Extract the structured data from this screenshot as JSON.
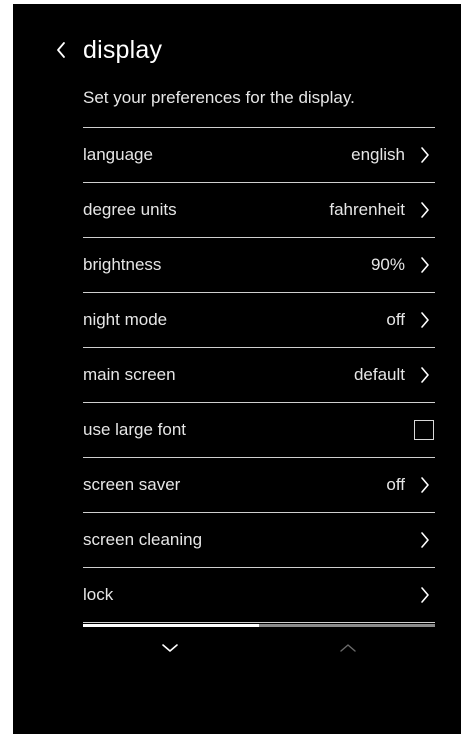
{
  "header": {
    "title": "display",
    "back_icon": "chevron-left-icon"
  },
  "subtitle": "Set your preferences for the display.",
  "settings": [
    {
      "label": "language",
      "value": "english",
      "control": "chevron"
    },
    {
      "label": "degree units",
      "value": "fahrenheit",
      "control": "chevron"
    },
    {
      "label": "brightness",
      "value": "90%",
      "control": "chevron"
    },
    {
      "label": "night mode",
      "value": "off",
      "control": "chevron"
    },
    {
      "label": "main screen",
      "value": "default",
      "control": "chevron"
    },
    {
      "label": "use large font",
      "value": "",
      "control": "checkbox",
      "checked": false
    },
    {
      "label": "screen saver",
      "value": "off",
      "control": "chevron"
    },
    {
      "label": "screen cleaning",
      "value": "",
      "control": "chevron"
    },
    {
      "label": "lock",
      "value": "",
      "control": "chevron"
    }
  ],
  "scroll": {
    "position_fraction": 0.5
  },
  "navigation": {
    "down_icon": "chevron-down-icon",
    "up_icon": "chevron-up-icon",
    "active_color": "#ffffff",
    "inactive_color": "#6a6a6a"
  }
}
